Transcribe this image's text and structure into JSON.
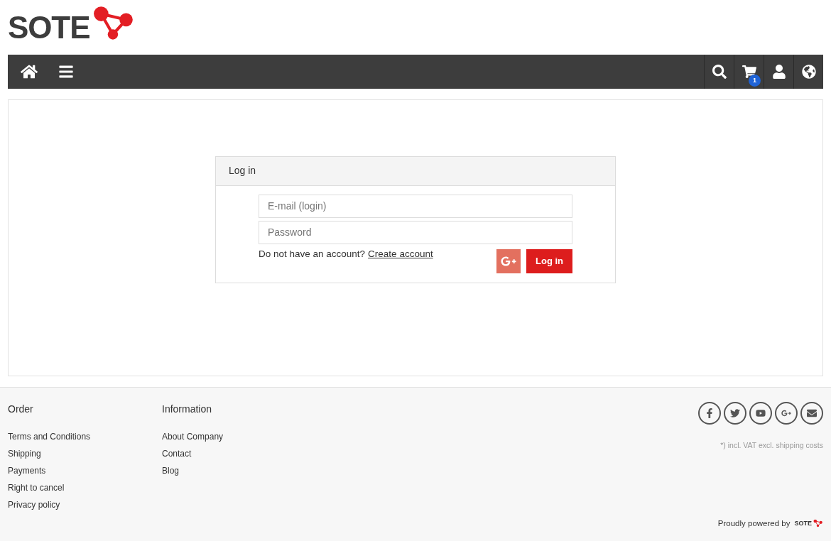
{
  "logo": {
    "text": "SOTE"
  },
  "navbar": {
    "cart_count": "1"
  },
  "login_panel": {
    "title": "Log in",
    "email": {
      "placeholder": "E-mail (login)"
    },
    "password": {
      "placeholder": "Password"
    },
    "signup_prompt": "Do not have an account?",
    "signup_link": "Create account",
    "submit": "Log in"
  },
  "footer": {
    "columns": [
      {
        "title": "Order",
        "links": [
          "Terms and Conditions",
          "Shipping",
          "Payments",
          "Right to cancel",
          "Privacy policy"
        ]
      },
      {
        "title": "Information",
        "links": [
          "About Company",
          "Contact",
          "Blog"
        ]
      }
    ],
    "tax_note": "*) incl. VAT excl. shipping costs",
    "powered_by": "Proudly powered by",
    "powered_logo": "SOTE"
  }
}
